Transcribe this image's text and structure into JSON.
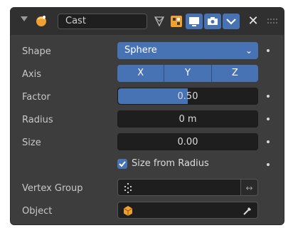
{
  "modifier": {
    "name": "Cast"
  },
  "rows": {
    "shape": {
      "label": "Shape",
      "value": "Sphere"
    },
    "axis": {
      "label": "Axis",
      "options": [
        "X",
        "Y",
        "Z"
      ]
    },
    "factor": {
      "label": "Factor",
      "value": "0.50",
      "fraction": 0.5
    },
    "radius": {
      "label": "Radius",
      "value": "0 m"
    },
    "size": {
      "label": "Size",
      "value": "0.00"
    },
    "size_from_radius": {
      "label": "Size from Radius",
      "checked": true
    },
    "vertex_group": {
      "label": "Vertex Group",
      "value": ""
    },
    "object": {
      "label": "Object",
      "value": ""
    }
  },
  "colors": {
    "accent": "#4772b3",
    "panel": "#3d3d3d",
    "field": "#1e1e1e"
  }
}
